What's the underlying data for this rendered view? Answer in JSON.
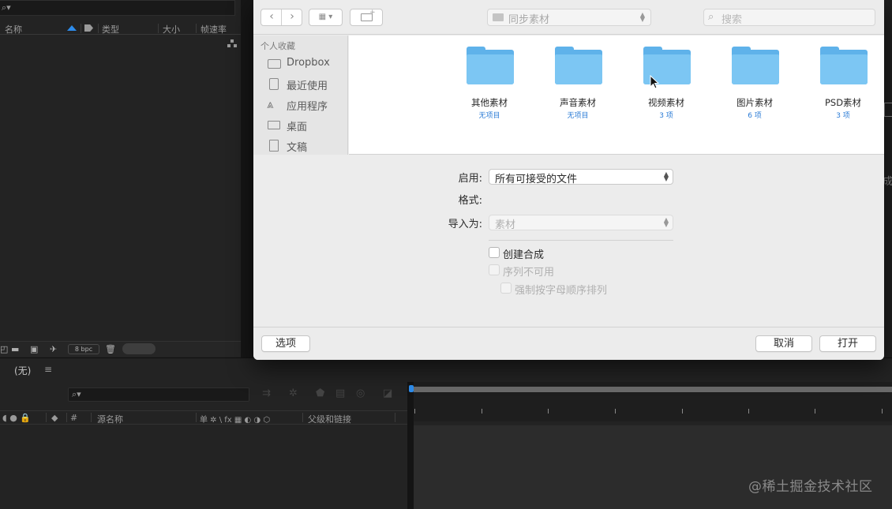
{
  "project_panel": {
    "columns": {
      "name": "名称",
      "type": "类型",
      "size": "大小",
      "framerate": "帧速率"
    },
    "bpc": "8 bpc"
  },
  "timeline": {
    "tab": "(无)",
    "menu": "≡",
    "columns": {
      "num": "#",
      "source_name": "源名称",
      "switches": "单 ✲ \\ fx ▦ ◐ ◑ ⬡",
      "parent": "父级和链接"
    }
  },
  "right_edge_text": "成",
  "watermark": "@稀土掘金技术社区",
  "dialog": {
    "path": "同步素材",
    "search_placeholder": "搜索",
    "sidebar": {
      "header": "个人收藏",
      "items": [
        {
          "label": "Dropbox",
          "icon": "folder-icon"
        },
        {
          "label": "最近使用",
          "icon": "recents-icon"
        },
        {
          "label": "应用程序",
          "icon": "applications-icon"
        },
        {
          "label": "桌面",
          "icon": "desktop-icon"
        },
        {
          "label": "文稿",
          "icon": "documents-icon"
        }
      ]
    },
    "folders": [
      {
        "name": "其他素材",
        "count": "无项目"
      },
      {
        "name": "声音素材",
        "count": "无项目"
      },
      {
        "name": "视频素材",
        "count": "3 项"
      },
      {
        "name": "图片素材",
        "count": "6 项"
      },
      {
        "name": "PSD素材",
        "count": "3 项"
      }
    ],
    "options": {
      "enable_label": "启用:",
      "enable_value": "所有可接受的文件",
      "format_label": "格式:",
      "import_as_label": "导入为:",
      "import_as_value": "素材",
      "create_comp": "创建合成",
      "sequence": "序列不可用",
      "force_alpha": "强制按字母顺序排列"
    },
    "buttons": {
      "options": "选项",
      "cancel": "取消",
      "open": "打开"
    }
  },
  "colors": {
    "accent": "#2d8ceb",
    "folder": "#7cc6f3",
    "link_count": "#2a7bd6"
  }
}
